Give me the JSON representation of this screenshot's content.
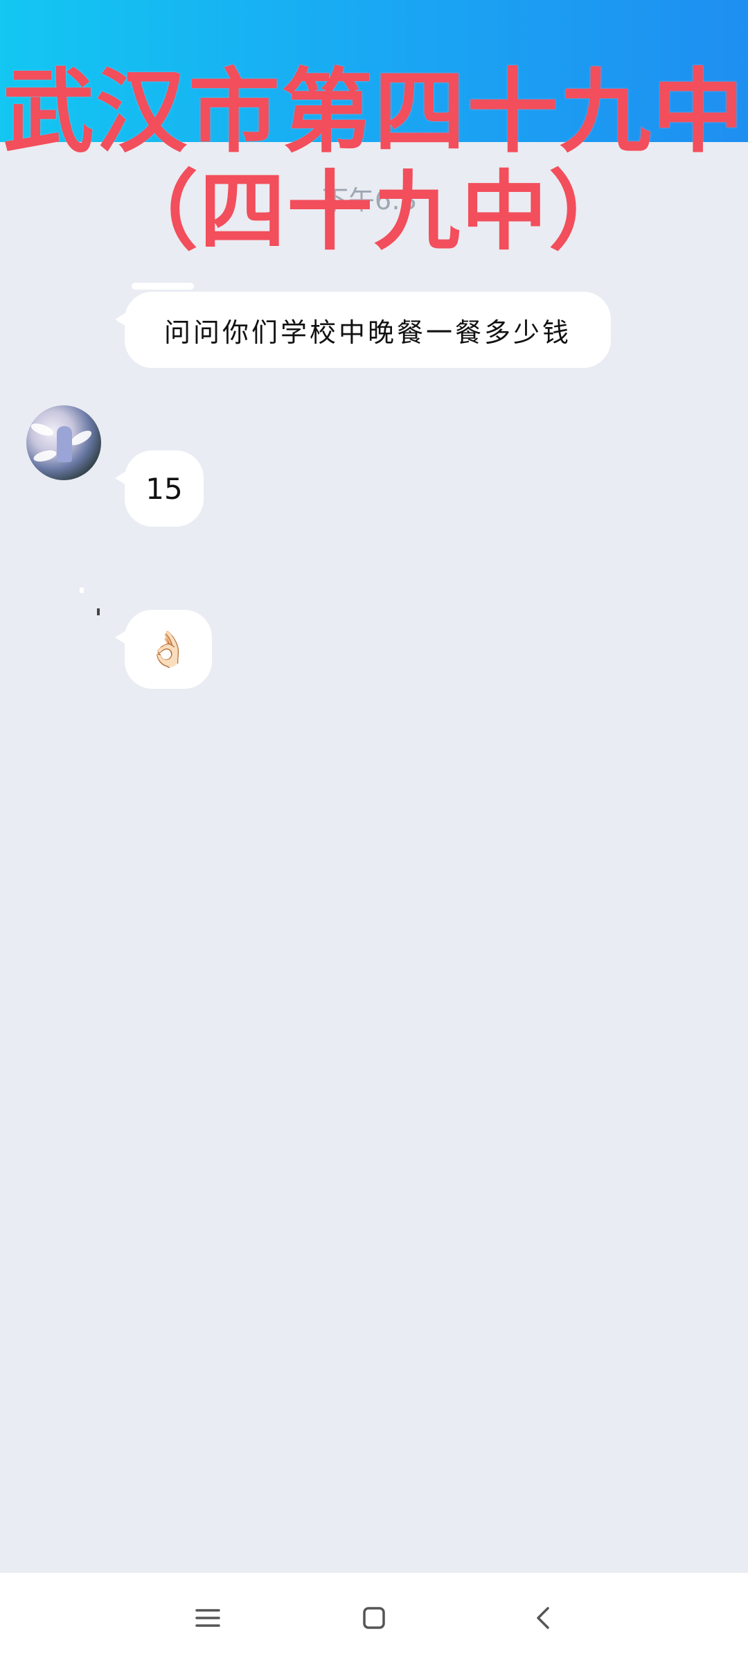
{
  "overlay": {
    "title_line1": "武汉市第四十九中",
    "title_line2": "（四十九中）"
  },
  "chat": {
    "timestamp": "下午6:3",
    "messages": [
      {
        "text": "问问你们学校中晚餐一餐多少钱"
      },
      {
        "text": "15"
      },
      {
        "text": "👌🏻"
      }
    ]
  },
  "nav": {
    "icons": [
      "menu-icon",
      "home-icon",
      "back-icon"
    ]
  },
  "colors": {
    "banner": "#1aa5f3",
    "overlay_text": "#f24e5c",
    "chat_background": "#e9ecf2",
    "bubble": "#ffffff"
  }
}
